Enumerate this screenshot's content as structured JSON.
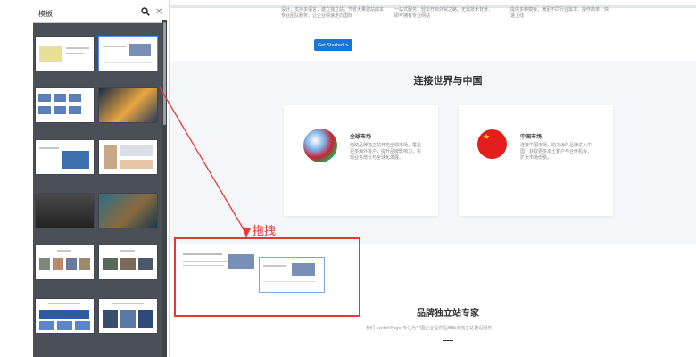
{
  "sidebar": {
    "search": {
      "value": "模板",
      "placeholder": ""
    }
  },
  "hero": {
    "col1": "设计，支持多语言，建立独立站，节省大量建站成本，专业团队服务，让企业快速走向国际",
    "col2": "一站式服务，轻松开启外贸之路，无需技术背景，即可拥有专业网站",
    "col3": "提供多种模板，满足不同行业需求，操作简单，快速上线",
    "cta": "Get Started >"
  },
  "connect": {
    "title": "连接世界与中国",
    "global": {
      "title": "全球市场",
      "text": "借助品牌独立站开拓全球市场，覆盖更多海外客户，提升品牌影响力，实现业务增长与全球化发展。"
    },
    "china": {
      "title": "中国市场",
      "text": "连接中国市场，助力海外品牌进入中国，获取更多本土客户与合作机会，扩大市场份额。"
    }
  },
  "drag": {
    "label": "拖拽"
  },
  "brand": {
    "title": "品牌独立站专家",
    "subtitle": "我们 switchPage 专注为中国企业提供品牌出海独立站建设服务"
  },
  "colors": {
    "accent": "#1976d2",
    "annotation": "#e53935",
    "sidebar": "#4b4f57"
  }
}
